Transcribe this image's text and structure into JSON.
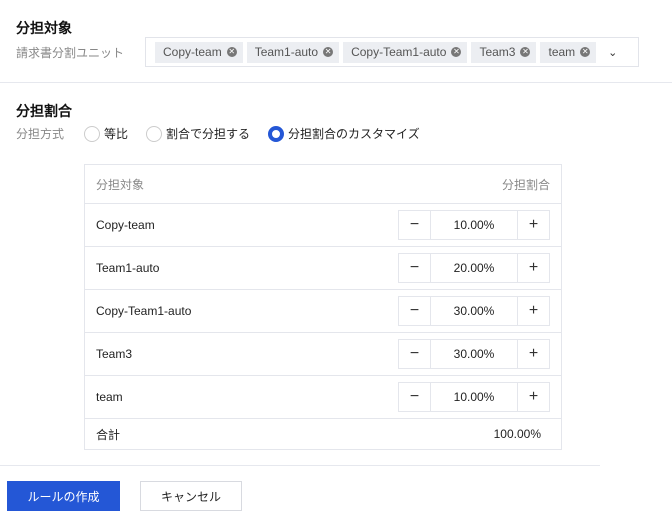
{
  "target_section": {
    "title": "分担対象",
    "field_label": "請求書分割ユニット",
    "tags": [
      "Copy-team",
      "Team1-auto",
      "Copy-Team1-auto",
      "Team3",
      "team"
    ]
  },
  "ratio_section": {
    "title": "分担割合",
    "method_label": "分担方式",
    "options": [
      {
        "label": "等比",
        "selected": false
      },
      {
        "label": "割合で分担する",
        "selected": false
      },
      {
        "label": "分担割合のカスタマイズ",
        "selected": true
      }
    ]
  },
  "table": {
    "headers": [
      "分担対象",
      "分担割合"
    ],
    "rows": [
      {
        "name": "Copy-team",
        "value": "10.00%"
      },
      {
        "name": "Team1-auto",
        "value": "20.00%"
      },
      {
        "name": "Copy-Team1-auto",
        "value": "30.00%"
      },
      {
        "name": "Team3",
        "value": "30.00%"
      },
      {
        "name": "team",
        "value": "10.00%"
      }
    ],
    "total_label": "合計",
    "total_value": "100.00%",
    "minus": "−",
    "plus": "+"
  },
  "actions": {
    "create": "ルールの作成",
    "cancel": "キャンセル"
  },
  "colors": {
    "primary": "#2457d6"
  }
}
